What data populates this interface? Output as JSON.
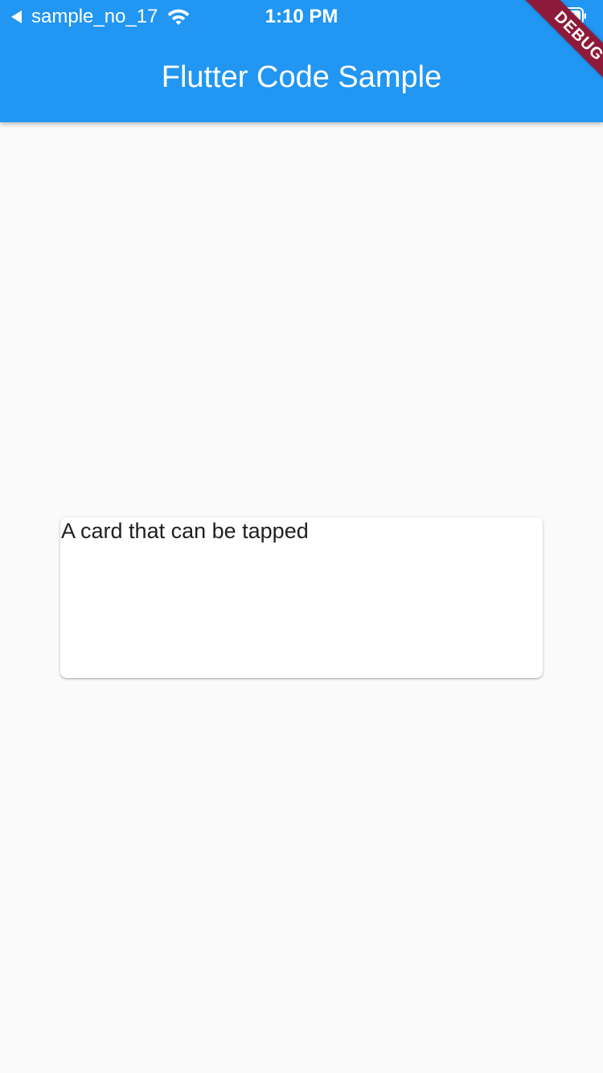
{
  "status_bar": {
    "back_app_name": "sample_no_17",
    "time": "1:10 PM"
  },
  "app_bar": {
    "title": "Flutter Code Sample",
    "color": "#2196f3"
  },
  "debug_banner": {
    "label": "DEBUG",
    "color": "#8e1a3a"
  },
  "card": {
    "text": "A card that can be tapped"
  },
  "icons": {
    "back": "back-triangle-icon",
    "wifi": "wifi-icon",
    "battery": "battery-icon"
  },
  "colors": {
    "background": "#fafafa",
    "card_background": "#ffffff"
  }
}
